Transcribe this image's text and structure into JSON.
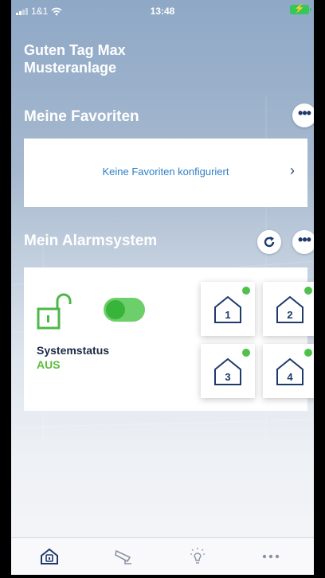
{
  "status_bar": {
    "carrier": "1&1",
    "time": "13:48"
  },
  "greeting": {
    "line1": "Guten Tag Max",
    "line2": "Musteranlage"
  },
  "favorites": {
    "title": "Meine Favoriten",
    "empty_text": "Keine Favoriten konfiguriert",
    "more_label": "•••"
  },
  "alarm": {
    "title": "Mein Alarmsystem",
    "more_label": "•••",
    "system_status_label": "Systemstatus",
    "system_status_value": "AUS",
    "armed": false,
    "zones": [
      "1",
      "2",
      "3",
      "4"
    ]
  },
  "colors": {
    "accent_blue": "#2e7fc6",
    "status_green": "#5bbd3b",
    "navy": "#1e3a6b"
  },
  "tabs": [
    {
      "icon": "home-shield-icon"
    },
    {
      "icon": "camera-icon"
    },
    {
      "icon": "lightbulb-icon"
    },
    {
      "icon": "more-icon"
    }
  ]
}
